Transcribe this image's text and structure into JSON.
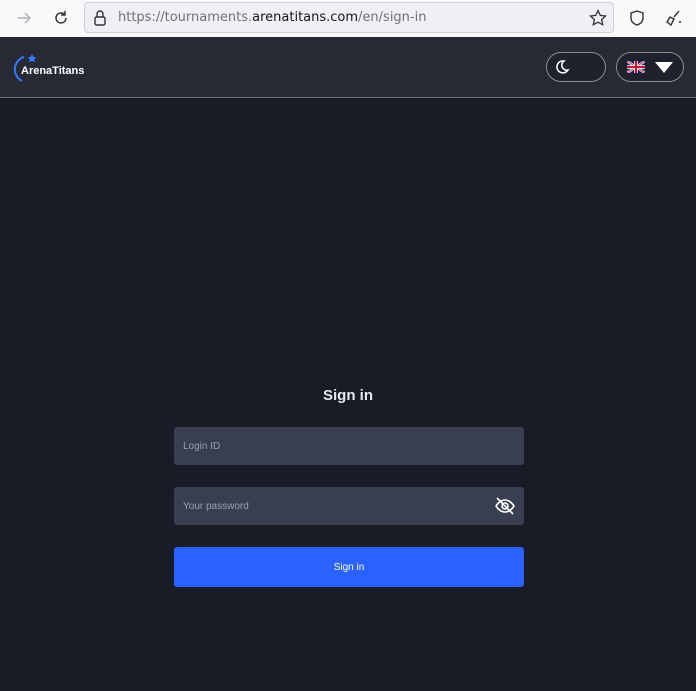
{
  "browser": {
    "url_prefix": "https://tournaments.",
    "url_domain": "arenatitans.com",
    "url_suffix": "/en/sign-in"
  },
  "header": {
    "logo_text": "ArenaTitans",
    "language": "en"
  },
  "form": {
    "title": "Sign in",
    "login_placeholder": "Login ID",
    "password_placeholder": "Your password",
    "submit_label": "Sign in"
  },
  "colors": {
    "accent": "#2962ff",
    "background": "#191c26",
    "header": "#272a35",
    "field": "#393e50"
  }
}
